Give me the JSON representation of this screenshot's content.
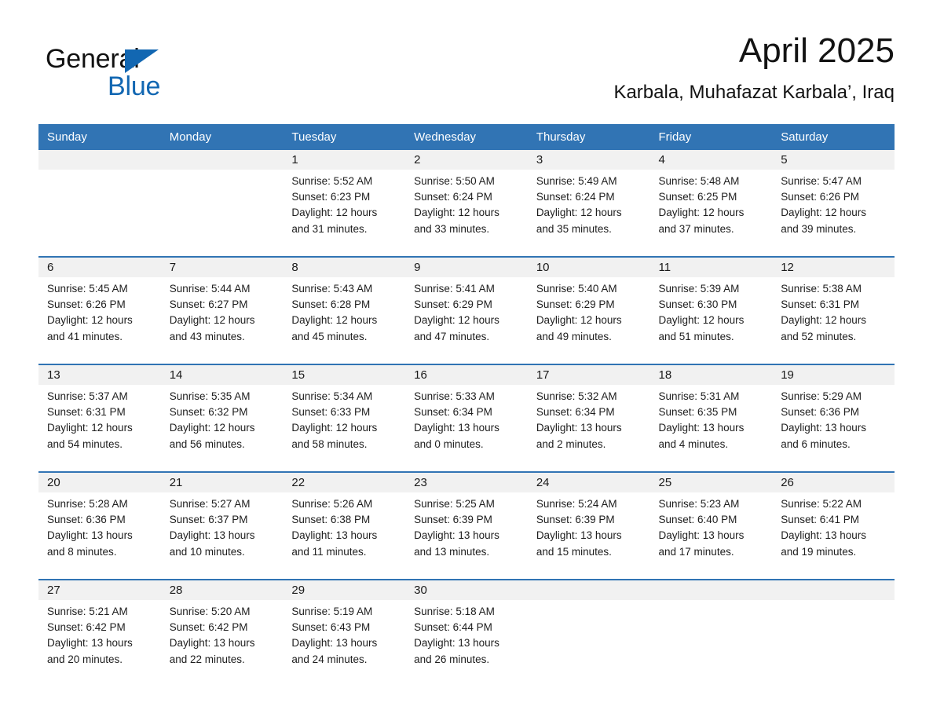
{
  "brand": {
    "name_part1": "General",
    "name_part2": "Blue",
    "triangle_color": "#1267b2"
  },
  "header": {
    "month_title": "April 2025",
    "location": "Karbala, Muhafazat Karbala’, Iraq"
  },
  "theme": {
    "header_blue": "#3174b4",
    "row_divider_blue": "#3174b4",
    "daynum_band": "#f1f1f1"
  },
  "calendar": {
    "weekday_headers": [
      "Sunday",
      "Monday",
      "Tuesday",
      "Wednesday",
      "Thursday",
      "Friday",
      "Saturday"
    ],
    "weeks": [
      [
        {
          "blank": true
        },
        {
          "blank": true
        },
        {
          "day": "1",
          "sunrise": "Sunrise: 5:52 AM",
          "sunset": "Sunset: 6:23 PM",
          "daylight_line1": "Daylight: 12 hours",
          "daylight_line2": "and 31 minutes."
        },
        {
          "day": "2",
          "sunrise": "Sunrise: 5:50 AM",
          "sunset": "Sunset: 6:24 PM",
          "daylight_line1": "Daylight: 12 hours",
          "daylight_line2": "and 33 minutes."
        },
        {
          "day": "3",
          "sunrise": "Sunrise: 5:49 AM",
          "sunset": "Sunset: 6:24 PM",
          "daylight_line1": "Daylight: 12 hours",
          "daylight_line2": "and 35 minutes."
        },
        {
          "day": "4",
          "sunrise": "Sunrise: 5:48 AM",
          "sunset": "Sunset: 6:25 PM",
          "daylight_line1": "Daylight: 12 hours",
          "daylight_line2": "and 37 minutes."
        },
        {
          "day": "5",
          "sunrise": "Sunrise: 5:47 AM",
          "sunset": "Sunset: 6:26 PM",
          "daylight_line1": "Daylight: 12 hours",
          "daylight_line2": "and 39 minutes."
        }
      ],
      [
        {
          "day": "6",
          "sunrise": "Sunrise: 5:45 AM",
          "sunset": "Sunset: 6:26 PM",
          "daylight_line1": "Daylight: 12 hours",
          "daylight_line2": "and 41 minutes."
        },
        {
          "day": "7",
          "sunrise": "Sunrise: 5:44 AM",
          "sunset": "Sunset: 6:27 PM",
          "daylight_line1": "Daylight: 12 hours",
          "daylight_line2": "and 43 minutes."
        },
        {
          "day": "8",
          "sunrise": "Sunrise: 5:43 AM",
          "sunset": "Sunset: 6:28 PM",
          "daylight_line1": "Daylight: 12 hours",
          "daylight_line2": "and 45 minutes."
        },
        {
          "day": "9",
          "sunrise": "Sunrise: 5:41 AM",
          "sunset": "Sunset: 6:29 PM",
          "daylight_line1": "Daylight: 12 hours",
          "daylight_line2": "and 47 minutes."
        },
        {
          "day": "10",
          "sunrise": "Sunrise: 5:40 AM",
          "sunset": "Sunset: 6:29 PM",
          "daylight_line1": "Daylight: 12 hours",
          "daylight_line2": "and 49 minutes."
        },
        {
          "day": "11",
          "sunrise": "Sunrise: 5:39 AM",
          "sunset": "Sunset: 6:30 PM",
          "daylight_line1": "Daylight: 12 hours",
          "daylight_line2": "and 51 minutes."
        },
        {
          "day": "12",
          "sunrise": "Sunrise: 5:38 AM",
          "sunset": "Sunset: 6:31 PM",
          "daylight_line1": "Daylight: 12 hours",
          "daylight_line2": "and 52 minutes."
        }
      ],
      [
        {
          "day": "13",
          "sunrise": "Sunrise: 5:37 AM",
          "sunset": "Sunset: 6:31 PM",
          "daylight_line1": "Daylight: 12 hours",
          "daylight_line2": "and 54 minutes."
        },
        {
          "day": "14",
          "sunrise": "Sunrise: 5:35 AM",
          "sunset": "Sunset: 6:32 PM",
          "daylight_line1": "Daylight: 12 hours",
          "daylight_line2": "and 56 minutes."
        },
        {
          "day": "15",
          "sunrise": "Sunrise: 5:34 AM",
          "sunset": "Sunset: 6:33 PM",
          "daylight_line1": "Daylight: 12 hours",
          "daylight_line2": "and 58 minutes."
        },
        {
          "day": "16",
          "sunrise": "Sunrise: 5:33 AM",
          "sunset": "Sunset: 6:34 PM",
          "daylight_line1": "Daylight: 13 hours",
          "daylight_line2": "and 0 minutes."
        },
        {
          "day": "17",
          "sunrise": "Sunrise: 5:32 AM",
          "sunset": "Sunset: 6:34 PM",
          "daylight_line1": "Daylight: 13 hours",
          "daylight_line2": "and 2 minutes."
        },
        {
          "day": "18",
          "sunrise": "Sunrise: 5:31 AM",
          "sunset": "Sunset: 6:35 PM",
          "daylight_line1": "Daylight: 13 hours",
          "daylight_line2": "and 4 minutes."
        },
        {
          "day": "19",
          "sunrise": "Sunrise: 5:29 AM",
          "sunset": "Sunset: 6:36 PM",
          "daylight_line1": "Daylight: 13 hours",
          "daylight_line2": "and 6 minutes."
        }
      ],
      [
        {
          "day": "20",
          "sunrise": "Sunrise: 5:28 AM",
          "sunset": "Sunset: 6:36 PM",
          "daylight_line1": "Daylight: 13 hours",
          "daylight_line2": "and 8 minutes."
        },
        {
          "day": "21",
          "sunrise": "Sunrise: 5:27 AM",
          "sunset": "Sunset: 6:37 PM",
          "daylight_line1": "Daylight: 13 hours",
          "daylight_line2": "and 10 minutes."
        },
        {
          "day": "22",
          "sunrise": "Sunrise: 5:26 AM",
          "sunset": "Sunset: 6:38 PM",
          "daylight_line1": "Daylight: 13 hours",
          "daylight_line2": "and 11 minutes."
        },
        {
          "day": "23",
          "sunrise": "Sunrise: 5:25 AM",
          "sunset": "Sunset: 6:39 PM",
          "daylight_line1": "Daylight: 13 hours",
          "daylight_line2": "and 13 minutes."
        },
        {
          "day": "24",
          "sunrise": "Sunrise: 5:24 AM",
          "sunset": "Sunset: 6:39 PM",
          "daylight_line1": "Daylight: 13 hours",
          "daylight_line2": "and 15 minutes."
        },
        {
          "day": "25",
          "sunrise": "Sunrise: 5:23 AM",
          "sunset": "Sunset: 6:40 PM",
          "daylight_line1": "Daylight: 13 hours",
          "daylight_line2": "and 17 minutes."
        },
        {
          "day": "26",
          "sunrise": "Sunrise: 5:22 AM",
          "sunset": "Sunset: 6:41 PM",
          "daylight_line1": "Daylight: 13 hours",
          "daylight_line2": "and 19 minutes."
        }
      ],
      [
        {
          "day": "27",
          "sunrise": "Sunrise: 5:21 AM",
          "sunset": "Sunset: 6:42 PM",
          "daylight_line1": "Daylight: 13 hours",
          "daylight_line2": "and 20 minutes."
        },
        {
          "day": "28",
          "sunrise": "Sunrise: 5:20 AM",
          "sunset": "Sunset: 6:42 PM",
          "daylight_line1": "Daylight: 13 hours",
          "daylight_line2": "and 22 minutes."
        },
        {
          "day": "29",
          "sunrise": "Sunrise: 5:19 AM",
          "sunset": "Sunset: 6:43 PM",
          "daylight_line1": "Daylight: 13 hours",
          "daylight_line2": "and 24 minutes."
        },
        {
          "day": "30",
          "sunrise": "Sunrise: 5:18 AM",
          "sunset": "Sunset: 6:44 PM",
          "daylight_line1": "Daylight: 13 hours",
          "daylight_line2": "and 26 minutes."
        },
        {
          "blank": true
        },
        {
          "blank": true
        },
        {
          "blank": true
        }
      ]
    ]
  }
}
